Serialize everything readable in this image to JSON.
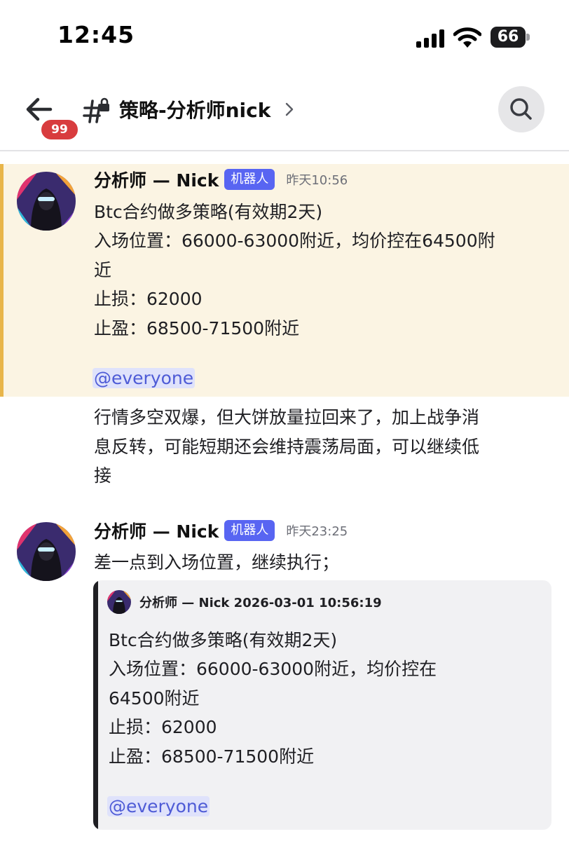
{
  "status_bar": {
    "time": "12:45",
    "battery": "66"
  },
  "header": {
    "unread_badge": "99",
    "channel_name": "策略-分析师nick",
    "chevron": "›",
    "icons": {
      "back": "arrow-left-icon",
      "channel": "hash-lock-icon",
      "search": "search-icon"
    }
  },
  "messages": [
    {
      "author": "分析师 — Nick",
      "tag": "机器人",
      "time": "昨天10:56",
      "highlighted": true,
      "lines": [
        "Btc合约做多策略(有效期2天)",
        "入场位置：66000-63000附近，均价控在64500附",
        "近",
        "止损：62000",
        "止盈：68500-71500附近"
      ],
      "mention": "@everyone"
    },
    {
      "continuation": true,
      "lines": [
        "行情多空双爆，但大饼放量拉回来了，加上战争消",
        "息反转，可能短期还会维持震荡局面，可以继续低",
        "接"
      ]
    },
    {
      "author": "分析师 — Nick",
      "tag": "机器人",
      "time": "昨天23:25",
      "lines": [
        "差一点到入场位置，继续执行；"
      ],
      "reply": {
        "meta": "分析师 — Nick 2026-03-01 10:56:19",
        "lines": [
          "Btc合约做多策略(有效期2天)",
          "入场位置：66000-63000附近，均价控在",
          "64500附近",
          "止损：62000",
          "止盈：68500-71500附近"
        ],
        "mention": "@everyone"
      }
    }
  ],
  "colors": {
    "accent": "#5865f2",
    "badge": "#d83c3e",
    "highlight_bg": "#fbf4e3",
    "highlight_bar": "#e8b54a",
    "mention_bg": "#dfe2fb"
  }
}
